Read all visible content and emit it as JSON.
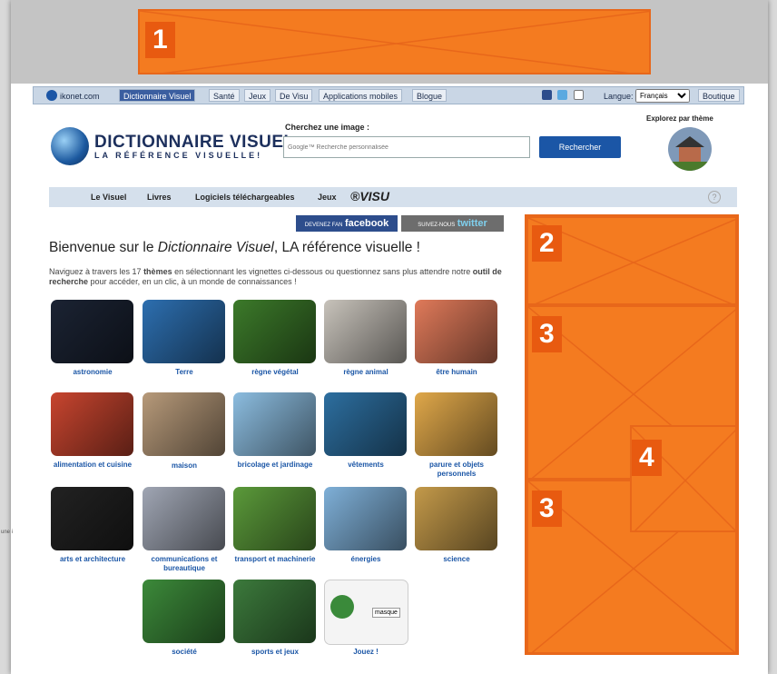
{
  "ad_labels": {
    "ad1": "1",
    "ad2": "2",
    "ad3a": "3",
    "ad3b": "3",
    "ad4": "4"
  },
  "toolbar": {
    "brand": "ikonet.com",
    "tabs": [
      "Dictionnaire Visuel",
      "Santé",
      "Jeux",
      "De Visu",
      "Applications mobiles",
      "Blogue"
    ],
    "language_label": "Langue:",
    "language_value": "Français",
    "shop": "Boutique"
  },
  "header": {
    "logo_title": "DICTIONNAIRE VISUEL",
    "logo_subtitle": "LA RÉFÉRENCE VISUELLE!",
    "search_label": "Cherchez une image :",
    "search_placeholder": "Google™ Recherche personnalisée",
    "search_button": "Rechercher",
    "explore_label": "Explorez par thème"
  },
  "subnav": {
    "items": [
      "Le Visuel",
      "Livres",
      "Logiciels téléchargeables",
      "Jeux"
    ],
    "visu_prefix": "®VISU",
    "help": "?"
  },
  "social": {
    "facebook_prefix": "DEVENEZ FAN",
    "facebook_word": "facebook",
    "twitter_prefix": "SUIVEZ-NOUS",
    "twitter_word": "twitter"
  },
  "welcome": {
    "title_before": "Bienvenue sur le ",
    "title_italic": "Dictionnaire Visuel",
    "title_after": ", LA référence visuelle !",
    "intro_1": "Naviguez à travers les 17 ",
    "intro_bold_1": "thèmes",
    "intro_2": " en sélectionnant les vignettes ci-dessous ou questionnez sans plus attendre notre ",
    "intro_bold_2": "outil de recherche",
    "intro_3": " pour accéder, en un clic, à un monde de connaissances !"
  },
  "themes": [
    {
      "label": "astronomie",
      "color": "#1b2333"
    },
    {
      "label": "Terre",
      "color": "#2d6fb0"
    },
    {
      "label": "règne végétal",
      "color": "#3c7a2a"
    },
    {
      "label": "règne animal",
      "color": "#c8c3bb"
    },
    {
      "label": "être humain",
      "color": "#e07a5a"
    },
    {
      "label": "alimentation et cuisine",
      "color": "#c8452f"
    },
    {
      "label": "maison",
      "color": "#b79a7a"
    },
    {
      "label": "bricolage et jardinage",
      "color": "#8cbde0"
    },
    {
      "label": "vêtements",
      "color": "#2d6fa0"
    },
    {
      "label": "parure et objets personnels",
      "color": "#e0a84a"
    },
    {
      "label": "arts et architecture",
      "color": "#222222"
    },
    {
      "label": "communications et bureautique",
      "color": "#a0a6b4"
    },
    {
      "label": "transport et machinerie",
      "color": "#5b9a3a"
    },
    {
      "label": "énergies",
      "color": "#7fb0d8"
    },
    {
      "label": "science",
      "color": "#c49a4a"
    },
    {
      "label": "société",
      "color": "#3c8a3a"
    },
    {
      "label": "sports et jeux",
      "color": "#3c7a3c"
    },
    {
      "label": "Jouez !",
      "color": "#eeeeee"
    }
  ],
  "game_tooltip": "masque",
  "side_text": "une i"
}
